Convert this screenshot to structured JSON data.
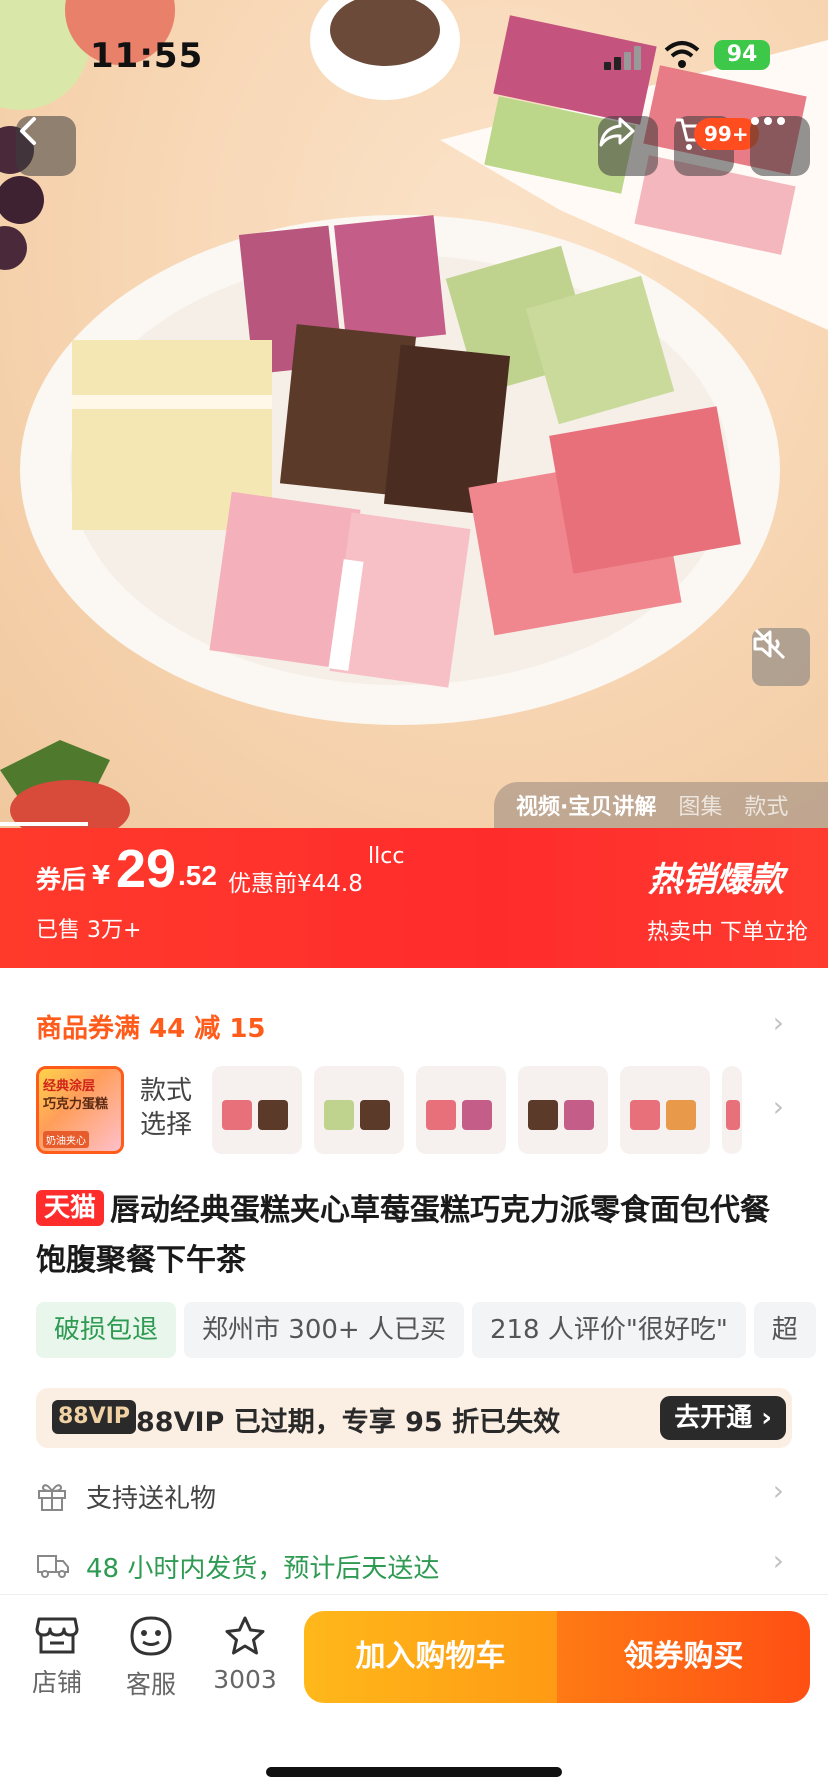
{
  "status_bar": {
    "time": "11:55",
    "battery": "94"
  },
  "top_nav": {
    "cart_badge": "99+"
  },
  "media_tabs": [
    {
      "label": "视频·宝贝讲解",
      "active": true
    },
    {
      "label": "图集",
      "active": false
    },
    {
      "label": "款式",
      "active": false
    }
  ],
  "price": {
    "after_coupon_label": "券后",
    "currency": "¥",
    "integer": "29",
    "decimal": ".52",
    "original": "优惠前¥44.8",
    "extra": "llcc",
    "sold": "已售 3万+",
    "hot_label": "热销爆款",
    "hot_sub": "热卖中 下单立抢"
  },
  "coupon": {
    "text": "商品券满 44 减 15"
  },
  "variants": {
    "label": "款式选择",
    "main_text_1": "经典涂层",
    "main_text_2": "巧克力蛋糕",
    "main_text_3": "奶油夹心"
  },
  "product": {
    "badge": "天猫",
    "title": "唇动经典蛋糕夹心草莓蛋糕巧克力派零食面包代餐饱腹聚餐下午茶"
  },
  "tags": [
    "破损包退",
    "郑州市 300+ 人已买",
    "218 人评价\"很好吃\"",
    "超"
  ],
  "vip": {
    "badge": "88VIP",
    "text": "88VIP 已过期，专享 95 折已失效",
    "button": "去开通"
  },
  "services": [
    {
      "icon": "gift-icon",
      "text": "支持送礼物"
    },
    {
      "icon": "delivery-truck-icon",
      "text": "48 小时内发货，预计后天送达"
    }
  ],
  "bottom_bar": {
    "store": "店铺",
    "service": "客服",
    "favorites": "3003",
    "add_to_cart": "加入购物车",
    "buy": "领券购买"
  },
  "colors": {
    "accent_red": "#ff2c2c",
    "accent_orange": "#ff5b1a",
    "green": "#2e9a52",
    "cart_button": "#ffb81a",
    "buy_button": "#ff5a14"
  }
}
